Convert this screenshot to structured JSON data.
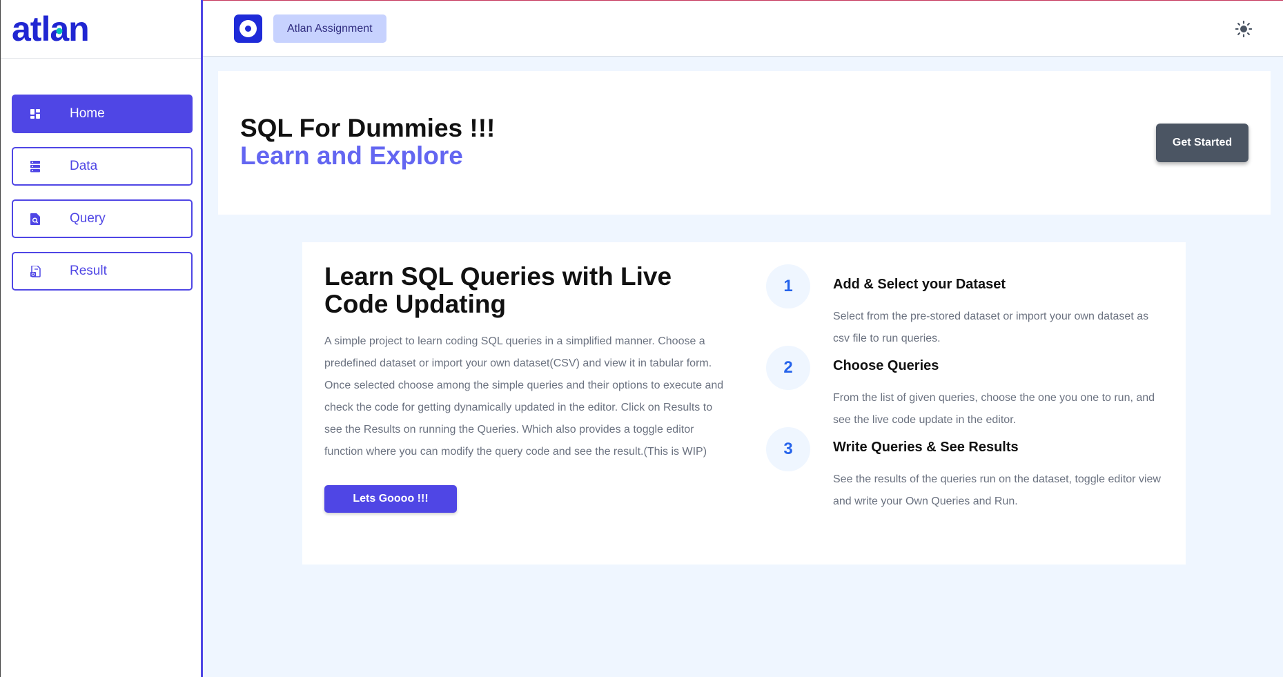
{
  "sidebar": {
    "logo_text": "atlan",
    "items": [
      {
        "label": "Home",
        "icon": "dashboard-icon",
        "active": true
      },
      {
        "label": "Data",
        "icon": "database-icon",
        "active": false
      },
      {
        "label": "Query",
        "icon": "file-search-icon",
        "active": false
      },
      {
        "label": "Result",
        "icon": "file-result-icon",
        "active": false
      }
    ]
  },
  "topbar": {
    "app_badge_icon": "atlan-a-icon",
    "chip_label": "Atlan Assignment",
    "theme_icon": "sun-icon"
  },
  "hero": {
    "title": "SQL For Dummies !!!",
    "subtitle": "Learn and Explore",
    "cta_label": "Get Started"
  },
  "card": {
    "title": "Learn SQL Queries with Live Code Updating",
    "description": "A simple project to learn coding SQL queries in a simplified manner. Choose a predefined dataset or import your own dataset(CSV) and view it in tabular form. Once selected choose among the simple queries and their options to execute and check the code for getting dynamically updated in the editor. Click on Results to see the Results on running the Queries. Which also provides a toggle editor function where you can modify the query code and see the result.(This is WIP)",
    "button_label": "Lets Goooo !!!",
    "steps": [
      {
        "number": "1",
        "title": "Add & Select your Dataset",
        "description": "Select from the pre-stored dataset or import your own dataset as csv file to run queries."
      },
      {
        "number": "2",
        "title": "Choose Queries",
        "description": "From the list of given queries, choose the one you one to run, and see the live code update in the editor."
      },
      {
        "number": "3",
        "title": "Write Queries & See Results",
        "description": "See the results of the queries run on the dataset, toggle editor view and write your Own Queries and Run."
      }
    ]
  },
  "colors": {
    "primary": "#4f46e5",
    "accent_text": "#6366f1",
    "logo_blue": "#2026d2",
    "logo_teal": "#00c2b8",
    "cta_dark": "#4b5563",
    "page_bg": "#eff6ff"
  }
}
